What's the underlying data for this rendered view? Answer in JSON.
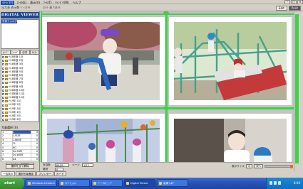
{
  "menubar": {
    "items": [
      "ｲﾒｰｼﾞ(F)",
      "ﾌｧｲﾙ(E)",
      "表示(V)",
      "ﾂｰﾙ(T)",
      "ｳｨﾝﾄﾞｳ(W)",
      "ヘルプ"
    ]
  },
  "toolbar": {
    "info_left": "出力表 表示数 ﾃﾞｨﾚｸﾄﾘ",
    "info_mid": "ｺﾒﾝﾄ 表 ｻﾑﾈｲﾙ",
    "btn_edit": "Edit",
    "btn_print": "Print"
  },
  "left_panel": {
    "brand": "DIGITAL VIEWER",
    "tree_header": "写真フォルダ",
    "tabs": [
      "ｶｰﾄﾞ",
      "ﾌｫﾙﾀﾞ",
      "日付",
      "ﾃｷｽﾄ"
    ],
    "files": [
      "H18年度 1月",
      "H18年度 2月",
      "H18年度 3月",
      "H18年度 4月",
      "H18年度 5月",
      "H18年度 6月",
      "H18年度 7月",
      "H18年度 8月",
      "H18年度 9月",
      "H18年度 10月",
      "H18年度 11月",
      "H18年度 12月",
      "H19年 1月",
      "H19年 2月",
      "H19年 3月",
      "H19年 4月",
      "H19年 5月",
      "H19年 6月"
    ],
    "selection_header": "写真選択 (0)",
    "selection_rows": [
      {
        "n": "1",
        "size": "L",
        "qty": "0"
      },
      {
        "n": "2",
        "size": "L-SIZE",
        "qty": "0"
      },
      {
        "n": "3",
        "size": "L-WIDE",
        "qty": "0"
      },
      {
        "n": "4",
        "size": "2L",
        "qty": "0"
      },
      {
        "n": "5",
        "size": "KG",
        "qty": "0"
      },
      {
        "n": "6",
        "size": "DL-SIZE",
        "qty": "0"
      },
      {
        "n": "7",
        "size": "DL-WIDE",
        "qty": "0"
      },
      {
        "n": "8",
        "size": "A4",
        "qty": "0"
      }
    ],
    "btn_order": "ｶｰﾄﾞへ一括追加",
    "btn_clear": "選択を全て解除"
  },
  "status": {
    "label_count": "写真数",
    "count_value": "89/89",
    "label_page": "ページ",
    "page_value": "1/23",
    "label_sel": "選択",
    "sel_value": "0",
    "zoom_label": "表示サイズ",
    "zoom_value": "小",
    "btn_next": "次へ"
  },
  "bottom_tabs": [
    "一覧表示",
    "選択写真確認",
    "プリンター",
    "カード"
  ],
  "taskbar": {
    "start": "start",
    "buttons": [
      "Windows Explorer",
      "ﾏｲﾄﾞｷｭﾒﾝﾄ",
      "ﾃﾞｼﾞﾀﾙﾋﾞｭｰｱ",
      "Digital Viewer",
      "画像ﾌｫﾙﾀﾞ"
    ],
    "active_index": 3,
    "clock": "8:06"
  },
  "colors": {
    "brand_bg": "#1e4696",
    "grid_line": "#3cd24a",
    "taskbar": "#2652b8"
  }
}
